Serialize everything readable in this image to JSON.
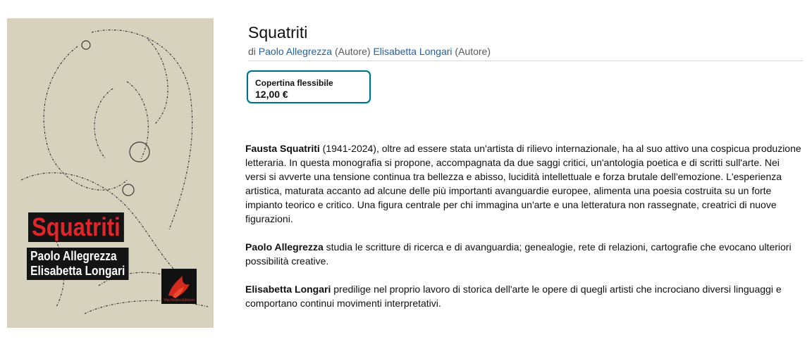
{
  "cover": {
    "title": "Squatriti",
    "author1": "Paolo Allegrezza",
    "author2": "Elisabetta Longari",
    "publisher": "Vita Nostra Edizioni"
  },
  "product": {
    "title": "Squatriti",
    "by_prefix": "di",
    "authors": [
      {
        "name": "Paolo Allegrezza",
        "role": "(Autore)"
      },
      {
        "name": "Elisabetta Longari",
        "role": "(Autore)"
      }
    ]
  },
  "format": {
    "label": "Copertina flessibile",
    "price": "12,00 €"
  },
  "description": {
    "p1_bold": "Fausta Squatriti",
    "p1_text": " (1941-2024), oltre ad essere stata un'artista di rilievo internazionale, ha al suo attivo una cospicua produzione letteraria. In questa monografia si propone, accompagnata da due saggi critici, un'antologia poetica e di scritti sull'arte. Nei versi si avverte una tensione continua tra bellezza e abisso, lucidità intellettuale e forza brutale dell'emozione. L'esperienza artistica, maturata accanto ad alcune delle più importanti avanguardie europee, alimenta una poesia costruita su un forte impianto teorico e critico. Una figura centrale per chi immagina un'arte e una letteratura non rassegnate, creatrici di nuove figurazioni.",
    "p2_bold": "Paolo Allegrezza",
    "p2_text": " studia le scritture di ricerca e di avanguardia; genealogie, rete di relazioni, cartografie che evocano ulteriori possibilità creative.",
    "p3_bold": "Elisabetta Longari",
    "p3_text": " predilige nel proprio lavoro di storica dell'arte le opere di quegli artisti che incrociano diversi linguaggi e comportano continui movimenti interpretativi."
  }
}
